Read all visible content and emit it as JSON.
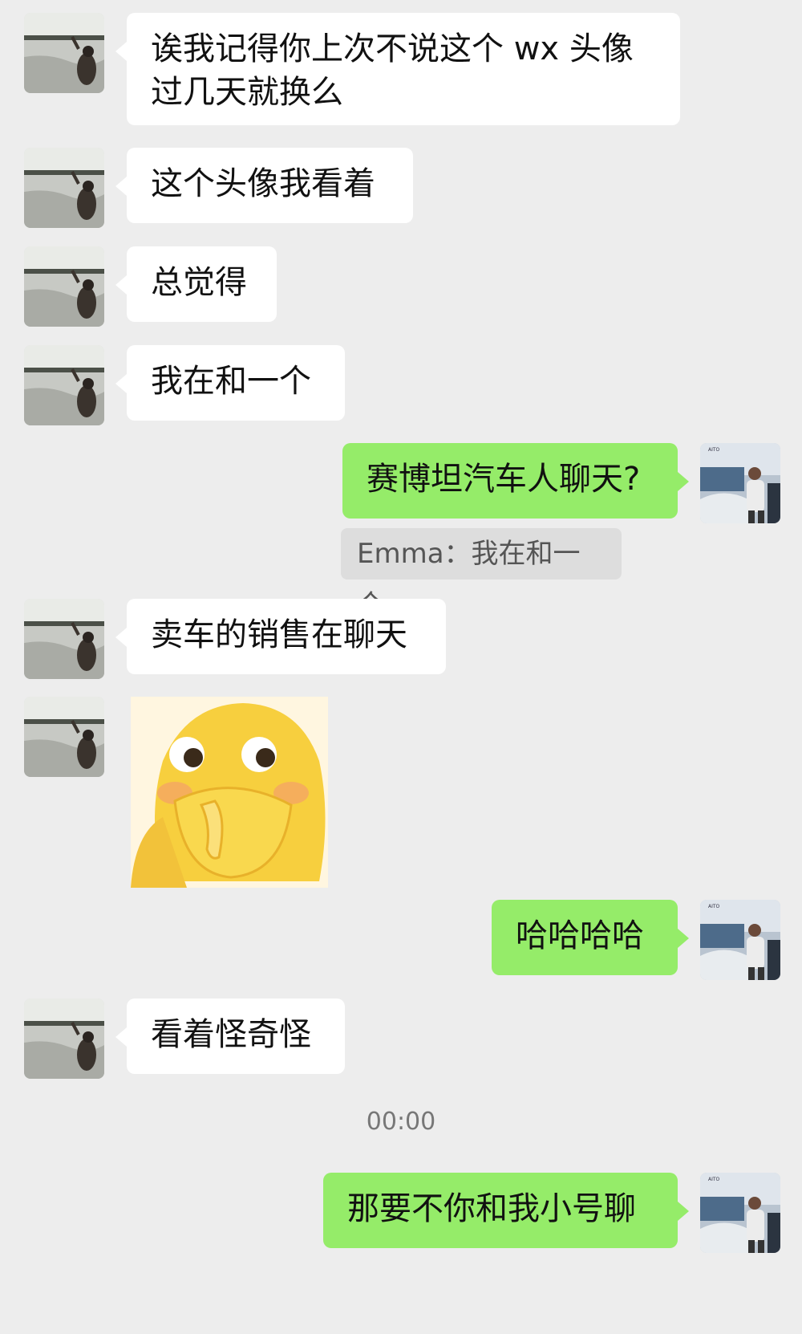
{
  "contacts": {
    "friend": {
      "name": "Emma",
      "avatar": "woman-by-lake-photo"
    },
    "self": {
      "avatar": "man-at-car-show-photo"
    }
  },
  "messages": [
    {
      "id": "m1",
      "sender": "friend",
      "type": "text",
      "text": "诶我记得你上次不说这个 wx 头像\n过几天就换么"
    },
    {
      "id": "m2",
      "sender": "friend",
      "type": "text",
      "text": "这个头像我看着"
    },
    {
      "id": "m3",
      "sender": "friend",
      "type": "text",
      "text": "总觉得"
    },
    {
      "id": "m4",
      "sender": "friend",
      "type": "text",
      "text": "我在和一个"
    },
    {
      "id": "m5",
      "sender": "self",
      "type": "text",
      "text": "赛博坦汽车人聊天?",
      "quote": "Emma：我在和一个"
    },
    {
      "id": "m6",
      "sender": "friend",
      "type": "text",
      "text": "卖车的销售在聊天"
    },
    {
      "id": "m7",
      "sender": "friend",
      "type": "sticker",
      "sticker": "yellow-duck-covering-mouth-sticker"
    },
    {
      "id": "m8",
      "sender": "self",
      "type": "text",
      "text": "哈哈哈哈"
    },
    {
      "id": "m9",
      "sender": "friend",
      "type": "text",
      "text": "看着怪奇怪"
    },
    {
      "id": "t1",
      "type": "timestamp",
      "text": "00:00"
    },
    {
      "id": "m10",
      "sender": "self",
      "type": "text",
      "text": "那要不你和我小号聊"
    }
  ],
  "colors": {
    "background": "#ededed",
    "incoming_bubble": "#ffffff",
    "outgoing_bubble": "#95ec69",
    "quote_bg": "#dddddd"
  }
}
